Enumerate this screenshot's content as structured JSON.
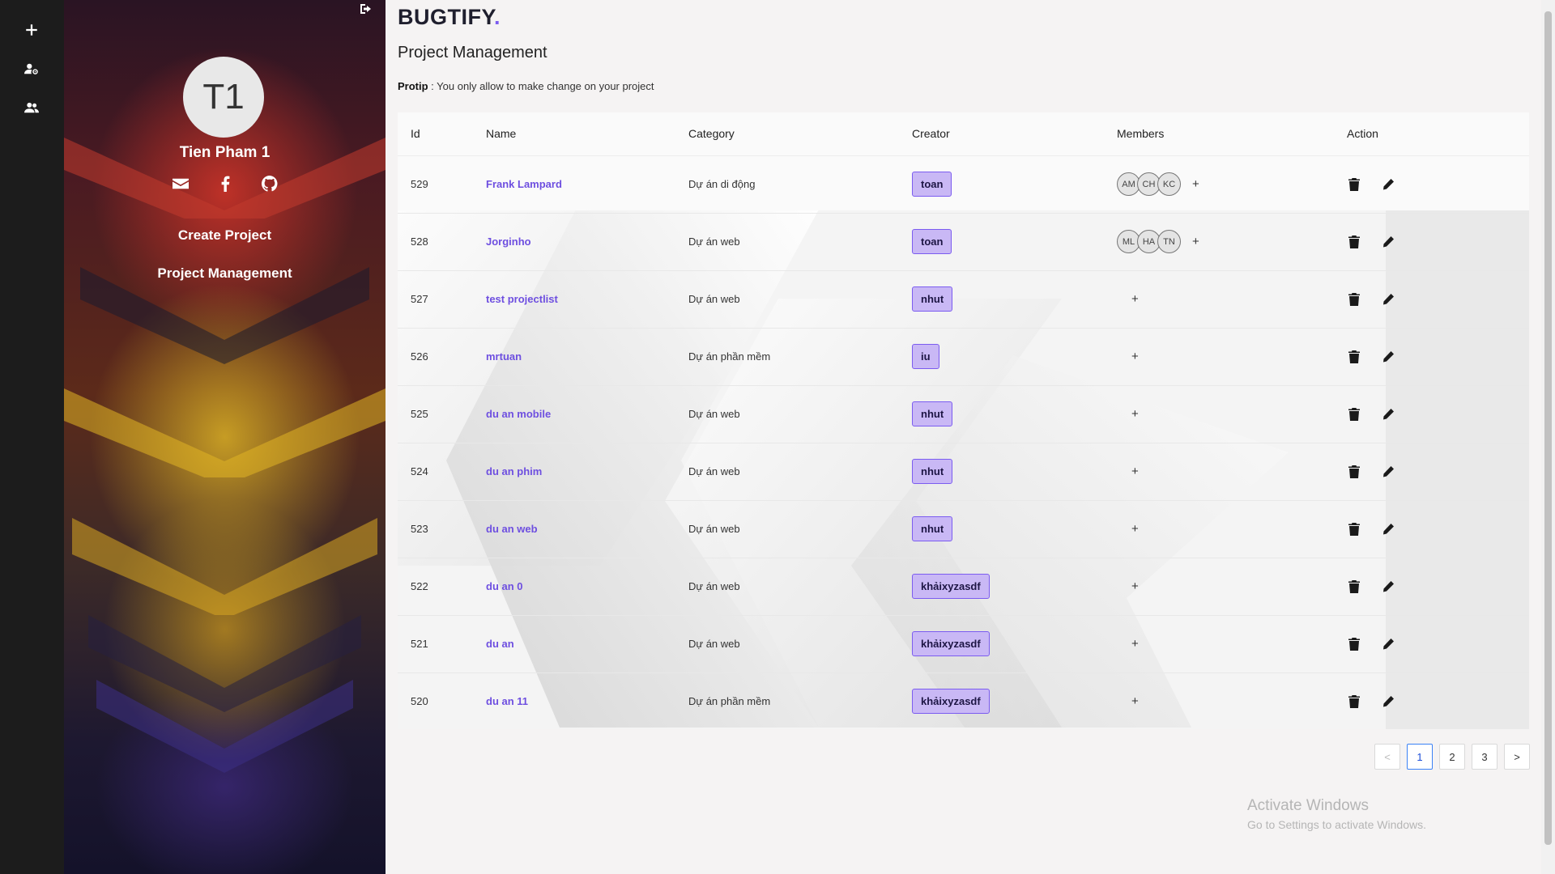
{
  "rail": {
    "items": [
      {
        "icon": "plus-icon",
        "name": "add"
      },
      {
        "icon": "user-cog-icon",
        "name": "user-settings"
      },
      {
        "icon": "users-icon",
        "name": "users"
      }
    ]
  },
  "profile": {
    "avatar_initials": "T1",
    "username": "Tien Pham 1",
    "social": [
      "envelope-icon",
      "facebook-icon",
      "github-icon"
    ],
    "nav": {
      "create_project": "Create Project",
      "project_management": "Project Management"
    }
  },
  "brand": {
    "name": "BUGTIFY",
    "dot": "."
  },
  "page": {
    "title": "Project Management",
    "protip_label": "Protip",
    "protip_text": " : You only allow to make change on your project"
  },
  "table": {
    "headers": {
      "id": "Id",
      "name": "Name",
      "category": "Category",
      "creator": "Creator",
      "members": "Members",
      "action": "Action"
    },
    "rows": [
      {
        "id": "529",
        "name": "Frank Lampard",
        "category": "Dự án di động",
        "creator": "toan",
        "members": [
          "AM",
          "CH",
          "KC"
        ]
      },
      {
        "id": "528",
        "name": "Jorginho",
        "category": "Dự án web",
        "creator": "toan",
        "members": [
          "ML",
          "HA",
          "TN"
        ]
      },
      {
        "id": "527",
        "name": "test projectlist",
        "category": "Dự án web",
        "creator": "nhut",
        "members": []
      },
      {
        "id": "526",
        "name": "mrtuan",
        "category": "Dự án phần mềm",
        "creator": "iu",
        "members": []
      },
      {
        "id": "525",
        "name": "du an mobile",
        "category": "Dự án web",
        "creator": "nhut",
        "members": []
      },
      {
        "id": "524",
        "name": "du an phim",
        "category": "Dự án web",
        "creator": "nhut",
        "members": []
      },
      {
        "id": "523",
        "name": "du an web",
        "category": "Dự án web",
        "creator": "nhut",
        "members": []
      },
      {
        "id": "522",
        "name": "du an 0",
        "category": "Dự án web",
        "creator": "khảixyzasdf",
        "members": []
      },
      {
        "id": "521",
        "name": "du an",
        "category": "Dự án web",
        "creator": "khảixyzasdf",
        "members": []
      },
      {
        "id": "520",
        "name": "du an 11",
        "category": "Dự án phần mềm",
        "creator": "khảixyzasdf",
        "members": []
      }
    ],
    "add_member_label": "+"
  },
  "pagination": {
    "prev": "<",
    "pages": [
      "1",
      "2",
      "3"
    ],
    "current": "1",
    "next": ">"
  },
  "watermark": {
    "line1": "Activate Windows",
    "line2": "Go to Settings to activate Windows."
  },
  "colors": {
    "accent": "#7b5cf0",
    "tag_bg": "#c9b8f5",
    "rail_bg": "#1c1c1c"
  }
}
